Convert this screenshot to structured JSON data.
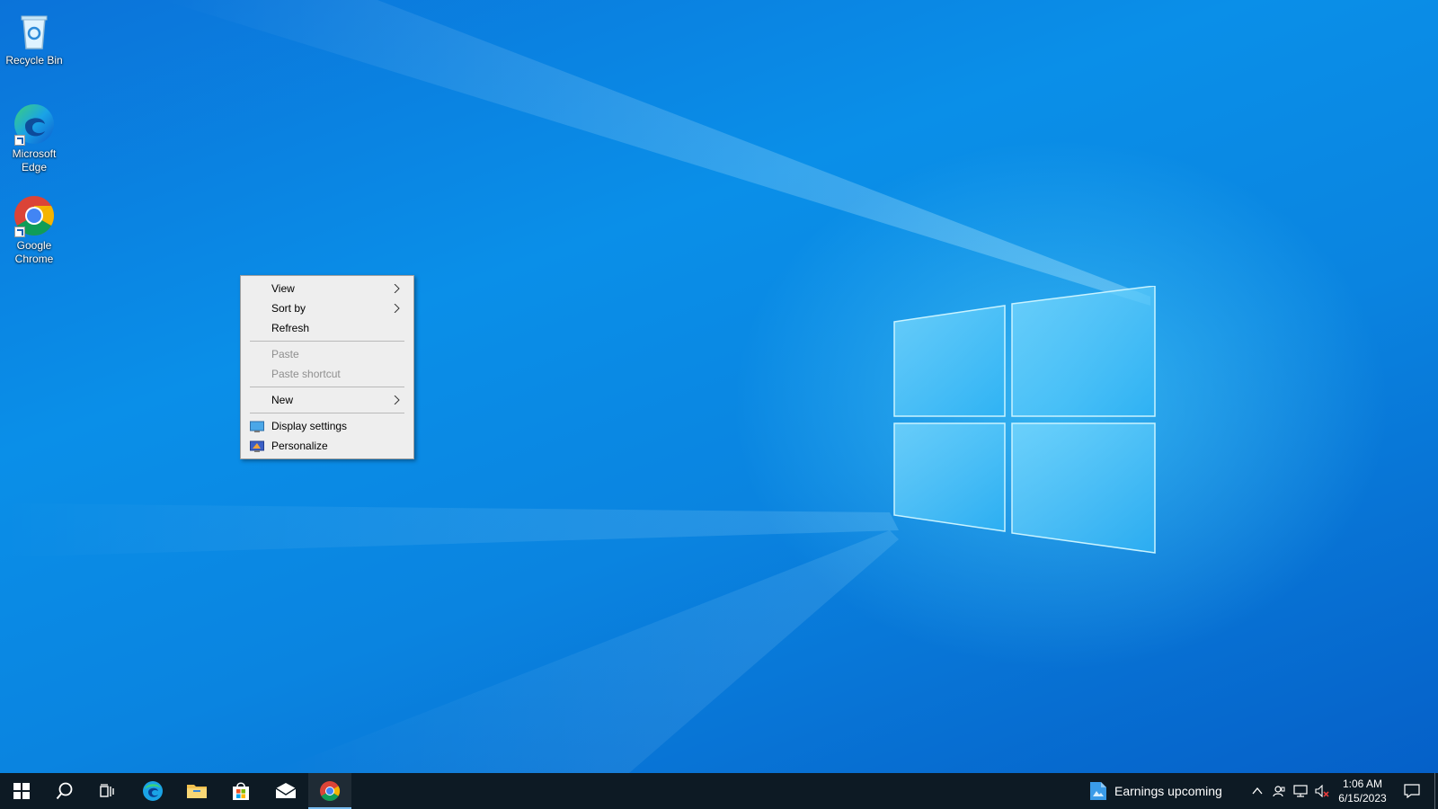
{
  "desktop": {
    "icons": [
      {
        "label": "Recycle Bin",
        "icon": "recycle-bin-icon"
      },
      {
        "label": "Microsoft Edge",
        "icon": "edge-icon",
        "shortcut": true
      },
      {
        "label": "Google Chrome",
        "icon": "chrome-icon",
        "shortcut": true
      }
    ]
  },
  "context_menu": {
    "items": [
      {
        "label": "View",
        "submenu": true,
        "enabled": true
      },
      {
        "label": "Sort by",
        "submenu": true,
        "enabled": true
      },
      {
        "label": "Refresh",
        "enabled": true
      },
      {
        "label": "Paste",
        "enabled": false
      },
      {
        "label": "Paste shortcut",
        "enabled": false
      },
      {
        "label": "New",
        "submenu": true,
        "enabled": true
      },
      {
        "label": "Display settings",
        "icon": "display-settings-icon",
        "enabled": true
      },
      {
        "label": "Personalize",
        "icon": "personalize-icon",
        "enabled": true
      }
    ]
  },
  "taskbar": {
    "buttons": [
      {
        "name": "start",
        "icon": "windows-start-icon"
      },
      {
        "name": "search",
        "icon": "search-icon"
      },
      {
        "name": "task-view",
        "icon": "task-view-icon"
      },
      {
        "name": "edge",
        "icon": "edge-icon"
      },
      {
        "name": "file-explorer",
        "icon": "folder-icon"
      },
      {
        "name": "store",
        "icon": "store-icon"
      },
      {
        "name": "mail",
        "icon": "mail-icon"
      },
      {
        "name": "chrome",
        "icon": "chrome-icon",
        "active": true
      }
    ],
    "news": {
      "text": "Earnings upcoming",
      "icon": "news-icon"
    },
    "tray": {
      "icons": [
        "chevron-up-icon",
        "meet-now-icon",
        "network-icon",
        "volume-muted-icon"
      ]
    },
    "clock": {
      "time": "1:06 AM",
      "date": "6/15/2023"
    },
    "notifications_icon": "notification-center-icon"
  },
  "colors": {
    "taskbar": "#0d1a24",
    "menu_bg": "#eeeeee",
    "accent": "#76b9ed",
    "desktop_blue": "#0a84e0"
  }
}
